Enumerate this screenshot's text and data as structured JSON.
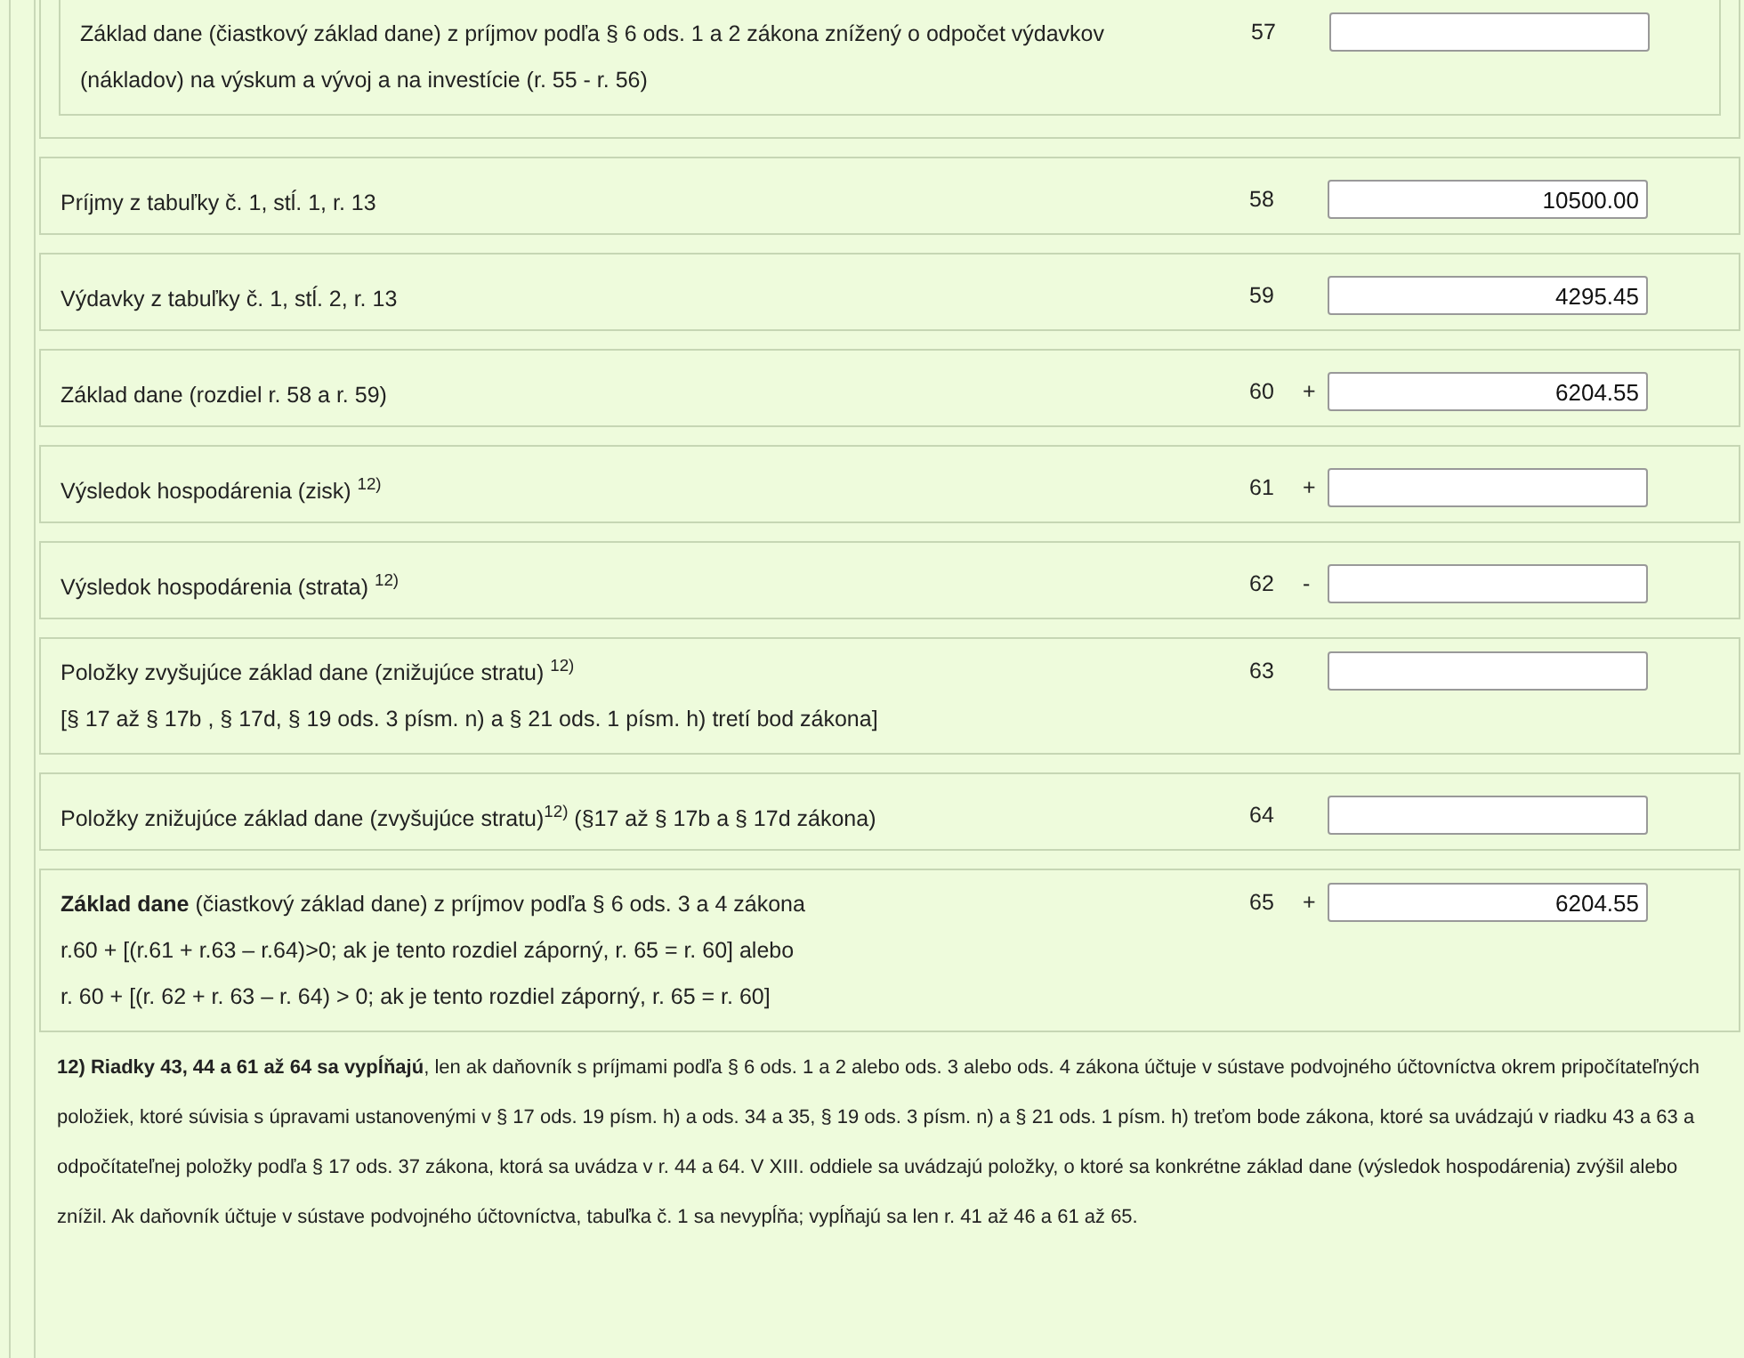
{
  "group_row": {
    "lines": [
      "Základ dane (čiastkový základ dane) z príjmov podľa § 6 ods. 1 a 2 zákona znížený o odpočet výdavkov",
      "(nákladov) na výskum a vývoj a na investície (r. 55 - r. 56)"
    ],
    "number": "57"
  },
  "rows": [
    {
      "lines": [
        "Príjmy z tabuľky č. 1, stĺ. 1, r. 13"
      ],
      "number": "58",
      "value": "10500.00"
    },
    {
      "lines": [
        "Výdavky z tabuľky č. 1, stĺ. 2, r. 13"
      ],
      "number": "59",
      "value": "4295.45"
    },
    {
      "lines": [
        "Základ dane (rozdiel r. 58 a r. 59)"
      ],
      "number": "60",
      "sign": "+",
      "value": "6204.55"
    },
    {
      "lines": [
        "Výsledok hospodárenia (zisk) $^{12)}$"
      ],
      "number": "61",
      "sign": "+"
    },
    {
      "lines": [
        "Výsledok hospodárenia (strata) $^{12)}$"
      ],
      "number": "62",
      "sign": "-"
    },
    {
      "lines": [
        "Položky zvyšujúce základ dane (znižujúce stratu) $^{12)}$",
        "[§ 17 až § 17b , § 17d, § 19 ods. 3 písm. n) a § 21 ods. 1 písm. h) tretí bod zákona]"
      ],
      "number": "63"
    },
    {
      "lines": [
        "Položky znižujúce základ dane (zvyšujúce stratu)$^{12)}$ (§17 až § 17b a § 17d zákona)"
      ],
      "number": "64"
    },
    {
      "lines": [
        "**Základ dane** (čiastkový základ dane) z príjmov podľa § 6 ods. 3 a 4 zákona",
        "r.60 + [(r.61 + r.63 – r.64)>0; ak je tento rozdiel záporný, r. 65 = r. 60] alebo",
        "r. 60 + [(r. 62 + r. 63 – r. 64) > 0; ak je tento rozdiel záporný, r. 65 = r. 60]"
      ],
      "number": "65",
      "sign": "+",
      "value": "6204.55"
    }
  ],
  "footnote": "**12) Riadky 43, 44 a 61 až 64 sa vypĺňajú**, len ak daňovník s príjmami podľa § 6 ods. 1 a 2 alebo ods. 3 alebo ods. 4 zákona účtuje v sústave podvojného účtovníctva okrem pripočítateľných položiek, ktoré súvisia s úpravami ustanovenými v § 17 ods. 19 písm. h) a ods. 34 a 35, § 19 ods. 3 písm. n) a § 21 ods. 1 písm. h) treťom bode zákona, ktoré sa uvádzajú v riadku 43 a 63 a odpočítateľnej položky podľa § 17 ods. 37 zákona, ktorá sa uvádza v r. 44 a 64. V XIII. oddiele sa uvádzajú položky, o ktoré sa konkrétne základ dane (výsledok hospodárenia) zvýšil alebo znížil. Ak daňovník účtuje v sústave podvojného účtovníctva, tabuľka č. 1 sa nevypĺňa; vypĺňajú sa len r. 41 až 46 a 61 až 65."
}
